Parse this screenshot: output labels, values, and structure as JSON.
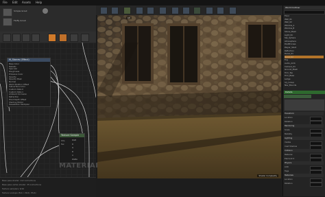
{
  "menu": [
    "File",
    "Edit",
    "Assets",
    "Help"
  ],
  "left_panel": {
    "header_labels": [
      "Simple Grout",
      "Fluffy Grout"
    ],
    "node_main": {
      "title": "M_Stones (Effect)",
      "pins": [
        "Base Color",
        "Metallic",
        "Specular",
        "Roughness",
        "Emissive Color",
        "Opacity",
        "Opacity Mask",
        "Normal",
        "World Position Offset",
        "Subsurface Color",
        "Custom Data 0",
        "Custom Data 1",
        "Ambient Occlusion",
        "Refraction",
        "Pixel Depth Offset",
        "Shading Model",
        "Tessellation Multiplier"
      ]
    },
    "node_small": {
      "title": "Texture Sample",
      "pins": [
        "UVs",
        "Tex",
        "RGB",
        "R",
        "G",
        "B",
        "A",
        "RGBA"
      ]
    },
    "watermark": "MATERIAL",
    "stats": [
      "Base pass shader: 112 instructions",
      "Base pass vertex shader: 35 instructions",
      "Texture samplers: 6/16",
      "Texture Lookups (Est.): VS(0), PS(4)"
    ]
  },
  "viewport": {
    "label": "Lit",
    "corner_label": "Shader Complexity"
  },
  "right_panel": {
    "title": "World Outliner",
    "outliner_items": [
      "Floor",
      "Wall_01",
      "Wall_02",
      "Window_A",
      "Window_B",
      "Stone_Mesh",
      "Light_Dir",
      "Sky_Sphere",
      "Atmosphere",
      "PostProcess",
      "Player_Start",
      "Reflection",
      "Decal_01",
      "Decal_02",
      "Fog",
      "Audio_Amb",
      "Camera_01",
      "Ground_Mesh",
      "Trim_Top",
      "Trim_Base",
      "Ledge",
      "Ivy_Group",
      "Nav_Bounds"
    ],
    "details_title": "Details",
    "detail_sections": [
      "Transform",
      "Rendering",
      "Lighting",
      "Collision",
      "Physics",
      "Materials"
    ],
    "detail_rows": [
      "Location",
      "Rotation",
      "Scale",
      "Mobility",
      "Visible",
      "Cast Shadow",
      "Material",
      "Element 0",
      "LOD",
      "Tags"
    ]
  }
}
